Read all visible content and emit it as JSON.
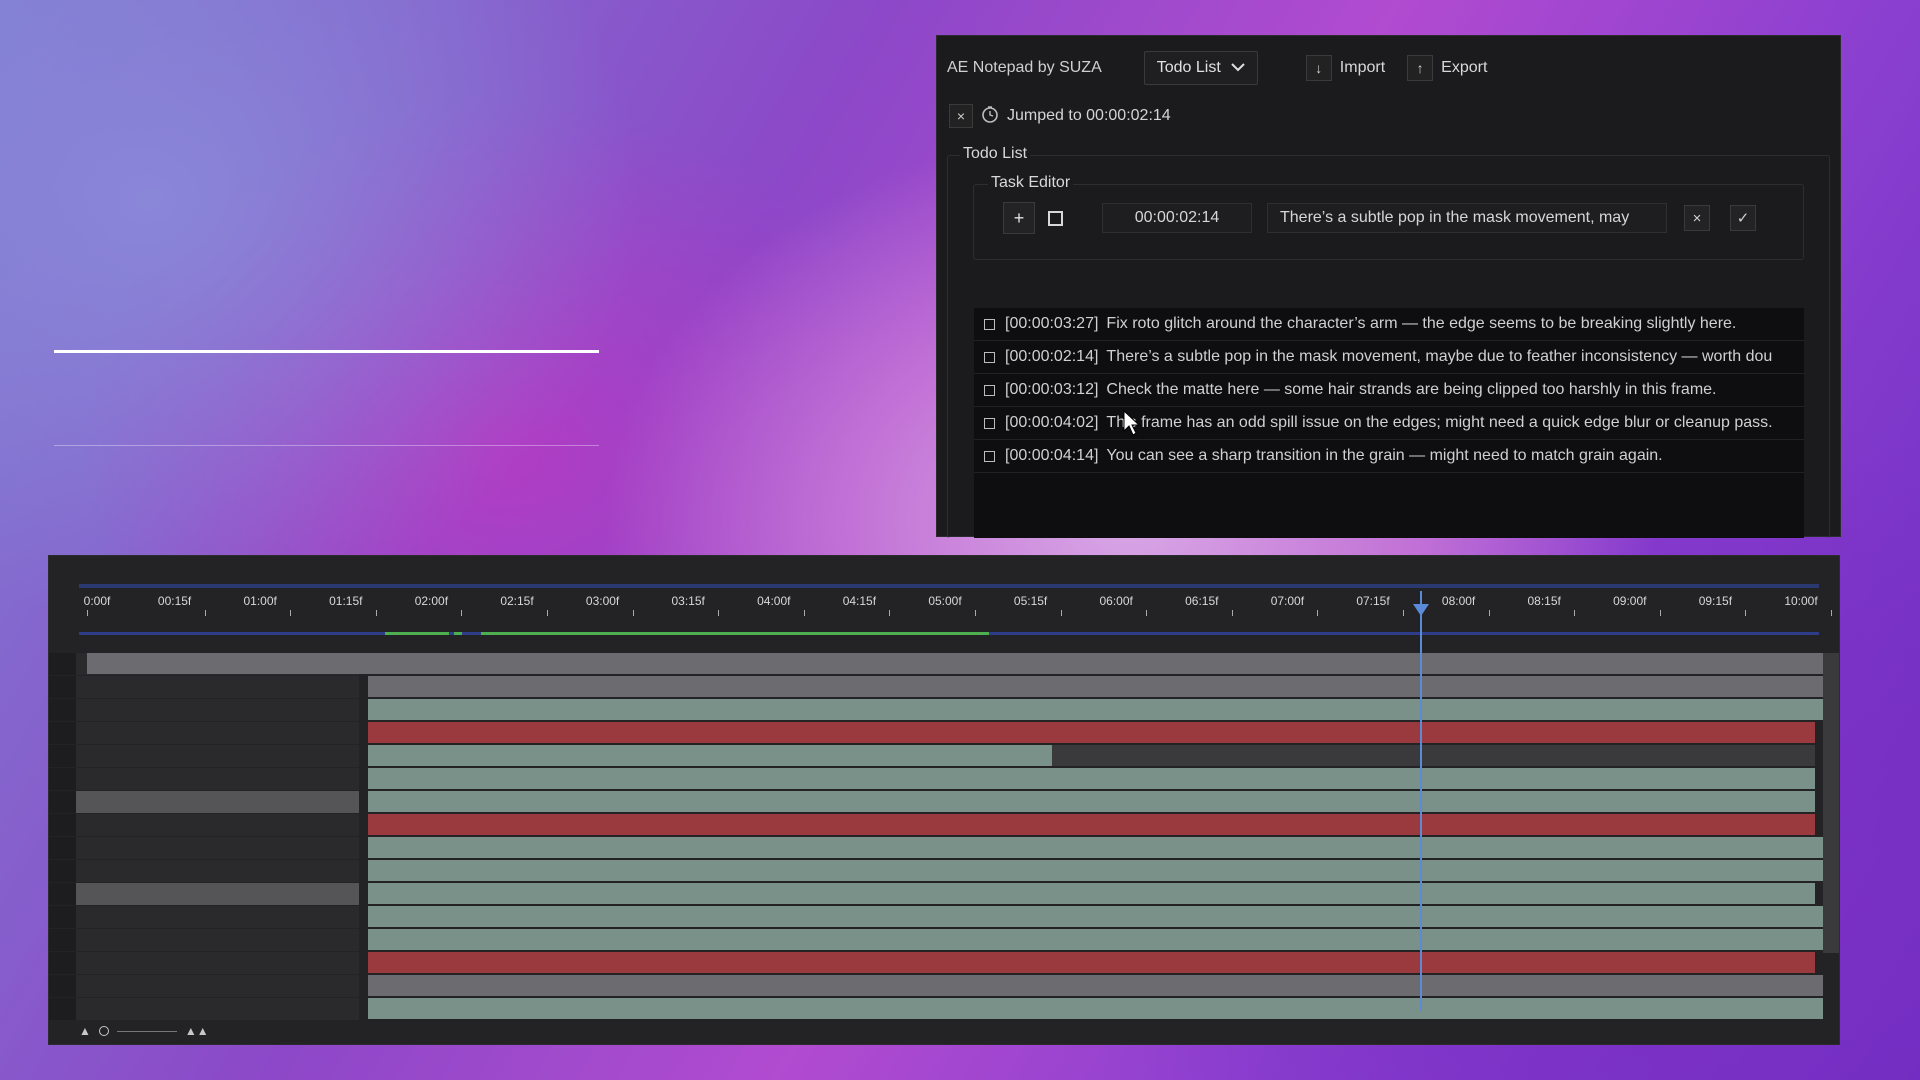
{
  "notepad": {
    "app_title": "AE Notepad by SUZA",
    "mode_dropdown": "Todo List",
    "import_label": "Import",
    "export_label": "Export",
    "status_text": "Jumped to 00:00:02:14",
    "todo_section_label": "Todo List",
    "task_editor": {
      "legend": "Task Editor",
      "add_symbol": "+",
      "time_value": "00:00:02:14",
      "text_value": "There’s a subtle pop in the mask movement, may",
      "cancel_symbol": "×",
      "confirm_symbol": "✓"
    },
    "tasks": [
      {
        "time": "[00:00:03:27]",
        "text": "Fix roto glitch around the character’s arm — the edge seems to be breaking slightly here.",
        "done": false
      },
      {
        "time": "[00:00:02:14]",
        "text": "There’s a subtle pop in the mask movement, maybe due to feather inconsistency — worth dou",
        "done": false
      },
      {
        "time": "[00:00:03:12]",
        "text": "Check the matte here — some hair strands are being clipped too harshly in this frame.",
        "done": false
      },
      {
        "time": "[00:00:04:02]",
        "text": "This frame has an odd spill issue on the edges; might need a quick edge blur or cleanup pass.",
        "done": false
      },
      {
        "time": "[00:00:04:14]",
        "text": "You can see a sharp transition in the grain — might need to match grain again.",
        "done": false
      }
    ]
  },
  "timeline": {
    "ruler_labels": [
      "0:00f",
      "00:15f",
      "01:00f",
      "01:15f",
      "02:00f",
      "02:15f",
      "03:00f",
      "03:15f",
      "04:00f",
      "04:15f",
      "05:00f",
      "05:15f",
      "06:00f",
      "06:15f",
      "07:00f",
      "07:15f",
      "08:00f",
      "08:15f",
      "09:00f",
      "09:15f",
      "10:00f"
    ],
    "playhead_time": "07:15f",
    "colors": {
      "teal": "#7a9189",
      "red": "#9b3a3e",
      "gray": "#6b6b70",
      "playhead": "#5a8ad8"
    }
  },
  "icons": {
    "dropdown": "chevron-down-icon",
    "import": "arrow-down-icon",
    "export": "arrow-up-icon",
    "status": "clock-icon",
    "close": "close-icon"
  }
}
